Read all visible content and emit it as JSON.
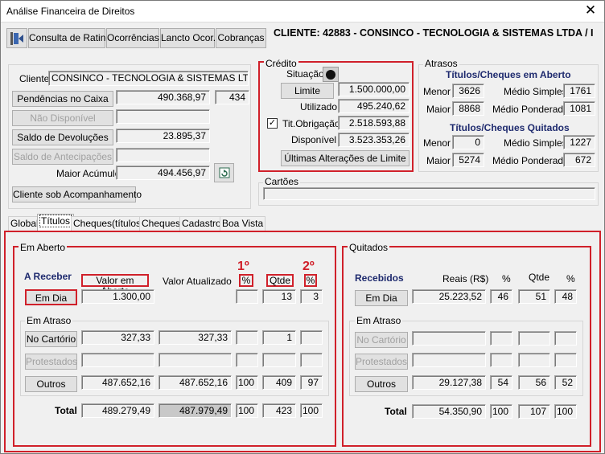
{
  "window": {
    "title": "Análise Financeira de Direitos",
    "close": "✕"
  },
  "toolbar": {
    "rating": "Consulta de Rating",
    "ocorrencias": "Ocorrências",
    "lancto": "Lancto Ocor.",
    "cobrancas": "Cobranças"
  },
  "client_header": "CLIENTE: 42883 - CONSINCO - TECNOLOGIA & SISTEMAS LTDA  /  I",
  "client": {
    "label": "Cliente",
    "name": "CONSINCO - TECNOLOGIA & SISTEMAS LTDA",
    "pend_label": "Pendências no Caixa",
    "pend_value": "490.368,97",
    "pend_count": "434",
    "nao_disp": "Não Disponível",
    "devol_label": "Saldo de Devoluções",
    "devol_value": "23.895,37",
    "antecip_label": "Saldo de Antecipações",
    "maior_label": "Maior Acúmulo",
    "maior_value": "494.456,97",
    "acomp": "Cliente sob Acompanhamento"
  },
  "credito": {
    "title": "Crédito",
    "situacao": "Situação",
    "limite_btn": "Limite",
    "limite": "1.500.000,00",
    "utilizado_label": "Utilizado",
    "utilizado": "495.240,62",
    "tit_label": "Tit.Obrigação",
    "tit": "2.518.593,88",
    "disp_label": "Disponível",
    "disp": "3.523.353,26",
    "ult": "Últimas Alterações de Limite"
  },
  "atrasos": {
    "title": "Atrasos",
    "aberto_title": "Títulos/Cheques em Aberto",
    "quit_title": "Títulos/Cheques Quitados",
    "menor": "Menor",
    "maior": "Maior",
    "medio_s": "Médio Simples",
    "medio_p": "Médio Ponderado",
    "ab_menor": "3626",
    "ab_maior": "8868",
    "ab_ms": "1761",
    "ab_mp": "1081",
    "q_menor": "0",
    "q_maior": "5274",
    "q_ms": "1227",
    "q_mp": "672"
  },
  "cartoes": {
    "title": "Cartões"
  },
  "tabs": [
    "Global",
    "Títulos",
    "Cheques(títulos)",
    "Cheques",
    "Cadastro",
    "Boa Vista"
  ],
  "aberto": {
    "title": "Em Aberto",
    "areceber": "A Receber",
    "valor_aberto": "Valor em Aberto",
    "valor_atual": "Valor Atualizado",
    "pct": "%",
    "qtde": "Qtde",
    "ord1": "1º",
    "ord2": "2º",
    "emdia_btn": "Em Dia",
    "emdia_val": "1.300,00",
    "emdia_qtde": "13",
    "emdia_pct2": "3",
    "atraso_title": "Em Atraso",
    "cart_btn": "No Cartório",
    "cart_val": "327,33",
    "cart_atual": "327,33",
    "cart_qtde": "1",
    "prot_btn": "Protestados",
    "out_btn": "Outros",
    "out_val": "487.652,16",
    "out_atual": "487.652,16",
    "out_pct": "100",
    "out_qtde": "409",
    "out_pct2": "97",
    "total_label": "Total",
    "tot_val": "489.279,49",
    "tot_atual": "487.979,49",
    "tot_pct": "100",
    "tot_qtde": "423",
    "tot_pct2": "100"
  },
  "quitados": {
    "title": "Quitados",
    "recebidos": "Recebidos",
    "reais": "Reais (R$)",
    "pct": "%",
    "qtde": "Qtde",
    "emdia_btn": "Em Dia",
    "emdia_val": "25.223,52",
    "emdia_pct": "46",
    "emdia_qtde": "51",
    "emdia_pct2": "48",
    "atraso_title": "Em Atraso",
    "cart_btn": "No Cartório",
    "prot_btn": "Protestados",
    "out_btn": "Outros",
    "out_val": "29.127,38",
    "out_pct": "54",
    "out_qtde": "56",
    "out_pct2": "52",
    "total_label": "Total",
    "tot_val": "54.350,90",
    "tot_pct": "100",
    "tot_qtde": "107",
    "tot_pct2": "100"
  },
  "colors": {
    "accent_red": "#d0202a",
    "heading_blue": "#1e2a6e"
  }
}
